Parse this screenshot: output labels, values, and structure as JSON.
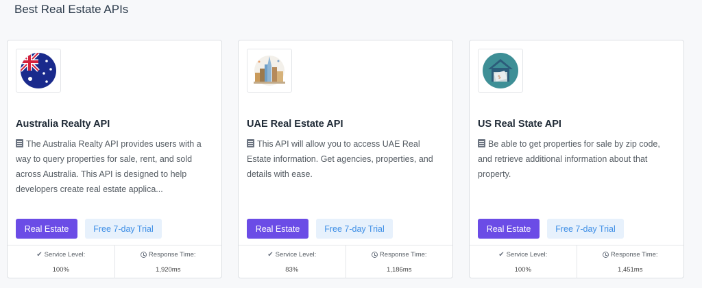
{
  "section": {
    "title": "Best Real Estate APIs"
  },
  "colors": {
    "primary": "#6b4ce6",
    "trial_bg": "#e7f1fc",
    "trial_text": "#3d8ee6"
  },
  "cards": [
    {
      "logo_icon": "australia-flag-icon",
      "title": "Australia Realty API",
      "description": "The Australia Realty API provides users with a way to query properties for sale, rent, and sold across Australia. This API is designed to help developers create real estate applica...",
      "category_button": "Real Estate",
      "trial_button": "Free 7-day Trial",
      "service_level_label": "Service Level:",
      "service_level": "100%",
      "response_time_label": "Response Time:",
      "response_time": "1,920ms"
    },
    {
      "logo_icon": "city-skyline-icon",
      "title": "UAE Real Estate API",
      "description": "This API will allow you to access UAE Real Estate information. Get agencies, properties, and details with ease.",
      "category_button": "Real Estate",
      "trial_button": "Free 7-day Trial",
      "service_level_label": "Service Level:",
      "service_level": "83%",
      "response_time_label": "Response Time:",
      "response_time": "1,186ms"
    },
    {
      "logo_icon": "house-sale-icon",
      "title": "US Real State API",
      "description": "Be able to get properties for sale by zip code, and retrieve additional information about that property.",
      "category_button": "Real Estate",
      "trial_button": "Free 7-day Trial",
      "service_level_label": "Service Level:",
      "service_level": "100%",
      "response_time_label": "Response Time:",
      "response_time": "1,451ms"
    }
  ]
}
